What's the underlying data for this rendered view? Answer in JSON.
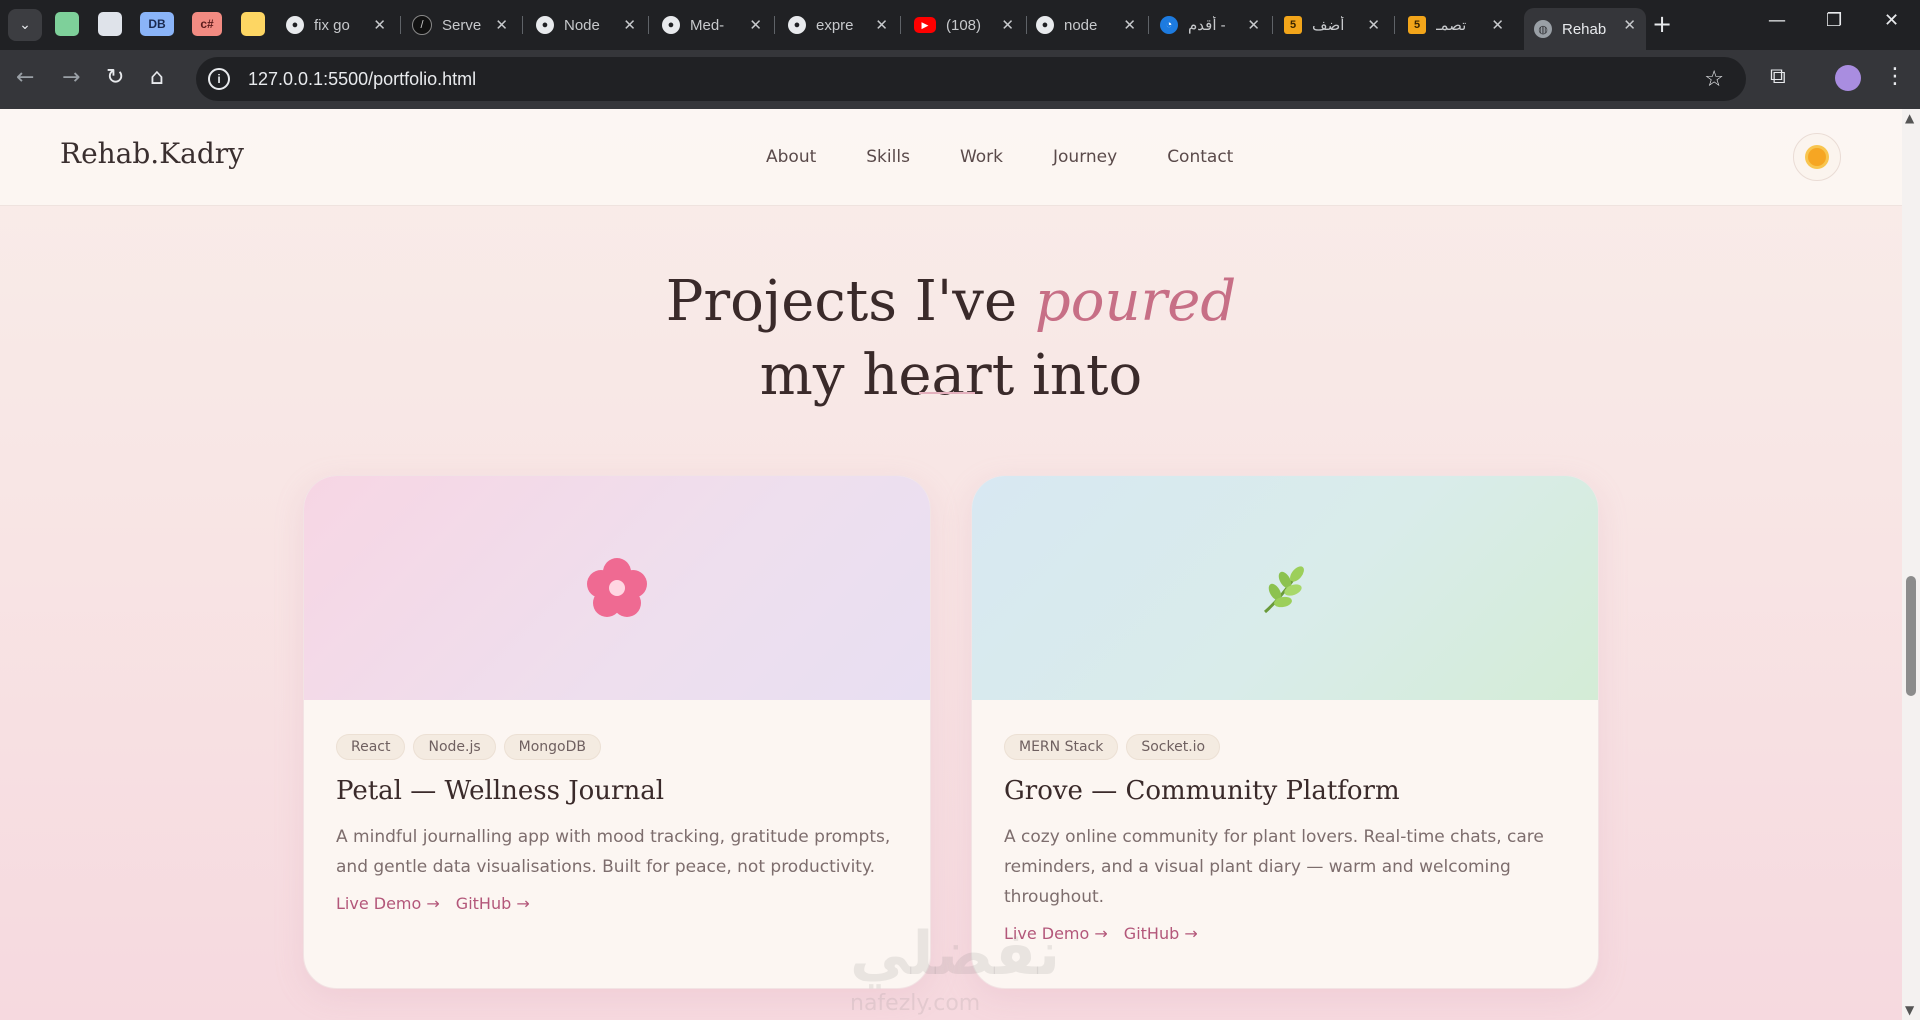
{
  "browser": {
    "tabs": [
      {
        "title": "fix go",
        "icon": "github-icon"
      },
      {
        "title": "Serve",
        "icon": "vercel-icon"
      },
      {
        "title": "Node",
        "icon": "github-icon"
      },
      {
        "title": "Med-",
        "icon": "github-icon"
      },
      {
        "title": "expre",
        "icon": "github-icon"
      },
      {
        "title": "(108)",
        "icon": "youtube-icon"
      },
      {
        "title": "node",
        "icon": "github-icon"
      },
      {
        "title": "أقدم -",
        "icon": "site-icon"
      },
      {
        "title": "أضف",
        "icon": "khamsat-icon"
      },
      {
        "title": "تصمـ",
        "icon": "khamsat-icon"
      },
      {
        "title": "Rehab",
        "icon": "globe-icon"
      }
    ],
    "pinned": [
      "",
      "",
      "DB",
      "c#",
      ""
    ],
    "url": "127.0.0.1:5500/portfolio.html"
  },
  "site": {
    "logo": "Rehab.Kadry",
    "nav": [
      "About",
      "Skills",
      "Work",
      "Journey",
      "Contact"
    ],
    "heading_part1": "Projects I've ",
    "heading_em": "poured",
    "heading_part2": "my heart into"
  },
  "projects": [
    {
      "tags": [
        "React",
        "Node.js",
        "MongoDB"
      ],
      "title": "Petal — Wellness Journal",
      "description": "A mindful journalling app with mood tracking, gratitude prompts, and gentle data visualisations. Built for peace, not productivity.",
      "links": [
        "Live Demo →",
        "GitHub →"
      ],
      "icon": "cherry-blossom-icon"
    },
    {
      "tags": [
        "MERN Stack",
        "Socket.io"
      ],
      "title": "Grove — Community Platform",
      "description": "A cozy online community for plant lovers. Real-time chats, care reminders, and a visual plant diary — warm and welcoming throughout.",
      "links": [
        "Live Demo →",
        "GitHub →"
      ],
      "icon": "herb-icon"
    }
  ],
  "watermark": {
    "text": "نفضلي",
    "sub": "nafezly.com"
  },
  "colors": {
    "accent": "#c76f86",
    "link": "#b3577a",
    "heading": "#3a2a2a"
  }
}
